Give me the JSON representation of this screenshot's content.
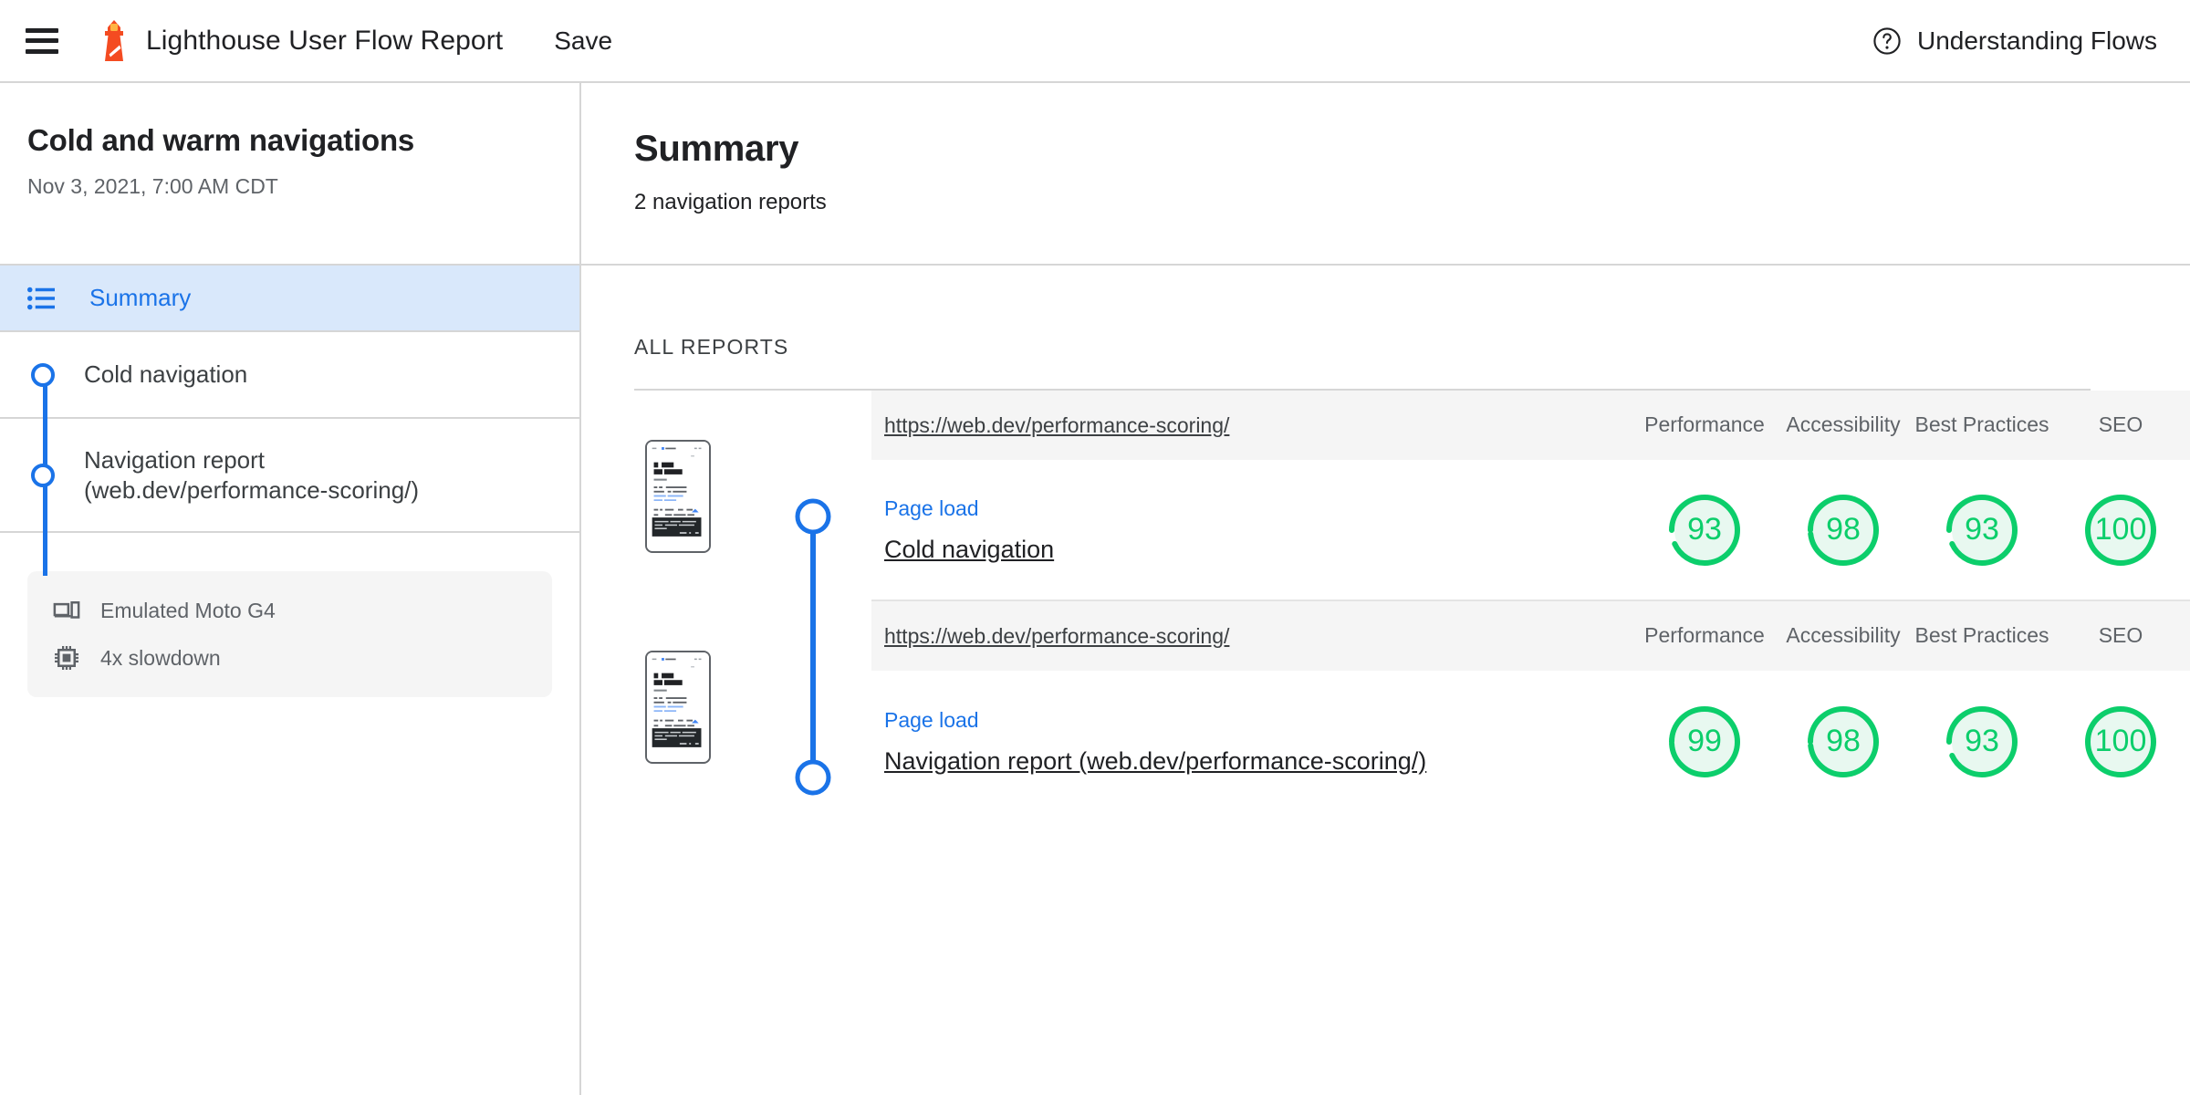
{
  "topbar": {
    "menu_icon": "hamburger-menu-icon",
    "logo_icon": "lighthouse-logo-icon",
    "title": "Lighthouse User Flow Report",
    "save_label": "Save",
    "help_icon": "help-circle-icon",
    "help_label": "Understanding Flows"
  },
  "sidebar": {
    "flow_title": "Cold and warm navigations",
    "flow_date": "Nov 3, 2021, 7:00 AM CDT",
    "nav": [
      {
        "icon": "list-bulleted-icon",
        "label": "Summary",
        "active": true
      },
      {
        "icon": "step-circle-icon",
        "label": "Cold navigation",
        "active": false
      },
      {
        "icon": "step-circle-icon",
        "label": "Navigation report (web.dev/performance-scoring/)",
        "active": false
      }
    ],
    "environment": [
      {
        "icon": "device-mobile-icon",
        "label": "Emulated Moto G4"
      },
      {
        "icon": "cpu-chip-icon",
        "label": "4x slowdown"
      }
    ]
  },
  "main": {
    "title": "Summary",
    "subtitle": "2 navigation reports",
    "all_reports_label": "ALL REPORTS",
    "categories": [
      "Performance",
      "Accessibility",
      "Best Practices",
      "SEO"
    ],
    "reports": [
      {
        "url": "https://web.dev/performance-scoring/",
        "step_type": "Page load",
        "step_name": "Cold navigation",
        "scores": [
          93,
          98,
          93,
          100
        ]
      },
      {
        "url": "https://web.dev/performance-scoring/",
        "step_type": "Page load",
        "step_name": "Navigation report (web.dev/performance-scoring/)",
        "scores": [
          99,
          98,
          93,
          100
        ]
      }
    ]
  },
  "colors": {
    "accent_blue": "#1a73e8",
    "score_green": "#0cce6b",
    "score_green_bg": "#e8f8f0",
    "brand_orange": "#f44b21",
    "header_row_bg": "#f5f5f5",
    "active_nav_bg": "#d9e8fb",
    "border_gray": "#d6d6d6"
  }
}
